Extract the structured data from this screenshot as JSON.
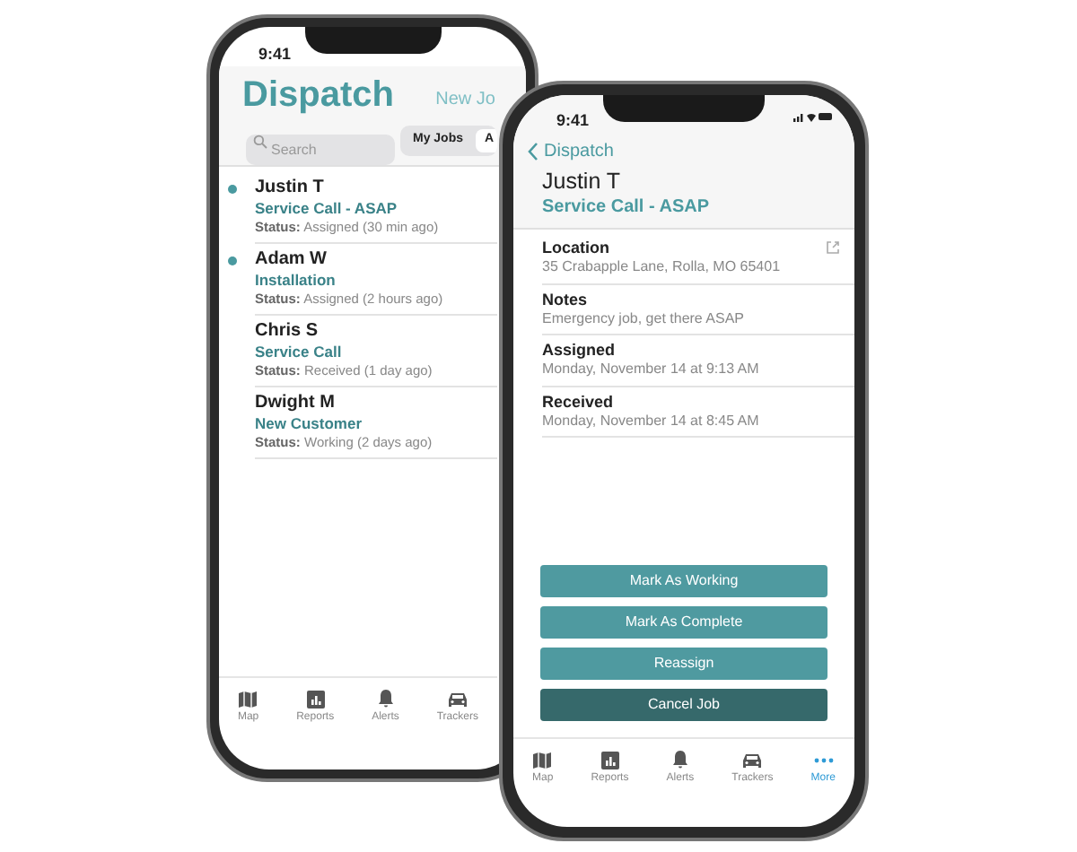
{
  "back_phone": {
    "status_time": "9:41",
    "title": "Dispatch",
    "new_button": "New Jo",
    "search": {
      "placeholder": "Search"
    },
    "segments": [
      {
        "label": "My Jobs",
        "selected": false
      },
      {
        "label": "A",
        "selected": true
      }
    ],
    "jobs": [
      {
        "name": "Justin T",
        "job_type": "Service Call - ASAP",
        "status": "**Status:** Assigned (30 min ago)",
        "unread": true
      },
      {
        "name": "Adam W",
        "job_type": "Installation",
        "status": "**Status:** Assigned (2 hours ago)",
        "unread": true
      },
      {
        "name": "Chris S",
        "job_type": "Service Call",
        "status": "**Status:** Received (1 day ago)",
        "unread": false
      },
      {
        "name": "Dwight M",
        "job_type": "New Customer",
        "status": "**Status:** Working (2 days ago)",
        "unread": false
      }
    ],
    "tabs": [
      {
        "label": "Map",
        "kind": "map",
        "selected": false
      },
      {
        "label": "Reports",
        "kind": "reports",
        "selected": false
      },
      {
        "label": "Alerts",
        "kind": "alerts",
        "selected": false
      },
      {
        "label": "Trackers",
        "kind": "trackers",
        "selected": false
      }
    ]
  },
  "front_phone": {
    "status_time": "9:41",
    "back_label": "Dispatch",
    "name": "Justin T",
    "job_type": "Service Call - ASAP",
    "fields": [
      {
        "label": "Location",
        "value": "35 Crabapple Lane, Rolla, MO 65401",
        "link": true
      },
      {
        "label": "Notes",
        "value": "Emergency job, get there ASAP",
        "link": false
      },
      {
        "label": "Assigned",
        "value": "Monday, November 14 at 9:13 AM",
        "link": false
      },
      {
        "label": "Received",
        "value": "Monday, November 14 at 8:45 AM",
        "link": false
      }
    ],
    "actions": [
      {
        "label": "Mark As Working",
        "kind": "primary"
      },
      {
        "label": "Mark As Complete",
        "kind": "primary"
      },
      {
        "label": "Reassign",
        "kind": "primary"
      },
      {
        "label": "Cancel Job",
        "kind": "danger"
      }
    ],
    "tabs": [
      {
        "label": "Map",
        "kind": "map",
        "selected": false
      },
      {
        "label": "Reports",
        "kind": "reports",
        "selected": false
      },
      {
        "label": "Alerts",
        "kind": "alerts",
        "selected": false
      },
      {
        "label": "Trackers",
        "kind": "trackers",
        "selected": false
      },
      {
        "label": "More",
        "kind": "more",
        "selected": true
      }
    ]
  }
}
